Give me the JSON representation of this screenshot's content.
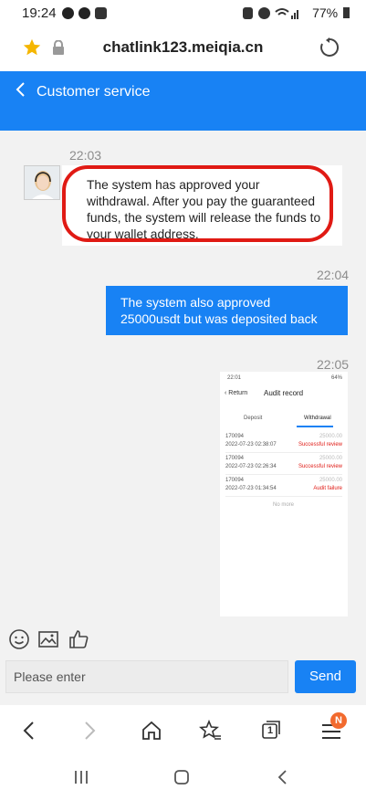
{
  "status_bar": {
    "time": "19:24",
    "battery": "77%"
  },
  "browser": {
    "url": "chatlink123.meiqia.cn"
  },
  "header": {
    "title": "Customer service"
  },
  "messages": [
    {
      "time": "22:03",
      "text": "The system has approved your withdrawal. After you pay the guaranteed funds, the system will release the funds to your wallet address."
    },
    {
      "time": "22:04",
      "text": "The system also approved 25000usdt but was deposited back"
    },
    {
      "time": "22:05"
    }
  ],
  "screenshot": {
    "status_time": "22:01",
    "battery": "64%",
    "back_label": "Return",
    "title": "Audit record",
    "tabs": [
      "Deposit",
      "Withdrawal"
    ],
    "records": [
      {
        "id": "170094",
        "datetime": "2022-07-23 02:38:07",
        "amount": "25000.00",
        "status": "Successful review"
      },
      {
        "id": "170094",
        "datetime": "2022-07-23 02:26:34",
        "amount": "25000.00",
        "status": "Successful review"
      },
      {
        "id": "170094",
        "datetime": "2022-07-23 01:34:54",
        "amount": "25000.00",
        "status": "Audit failure"
      }
    ],
    "footer": "No more"
  },
  "composer": {
    "placeholder": "Please enter",
    "send_label": "Send"
  },
  "browser_nav": {
    "tabs_count": "1",
    "badge": "N"
  },
  "colors": {
    "accent": "#1882f4",
    "highlight": "#e01a14"
  }
}
